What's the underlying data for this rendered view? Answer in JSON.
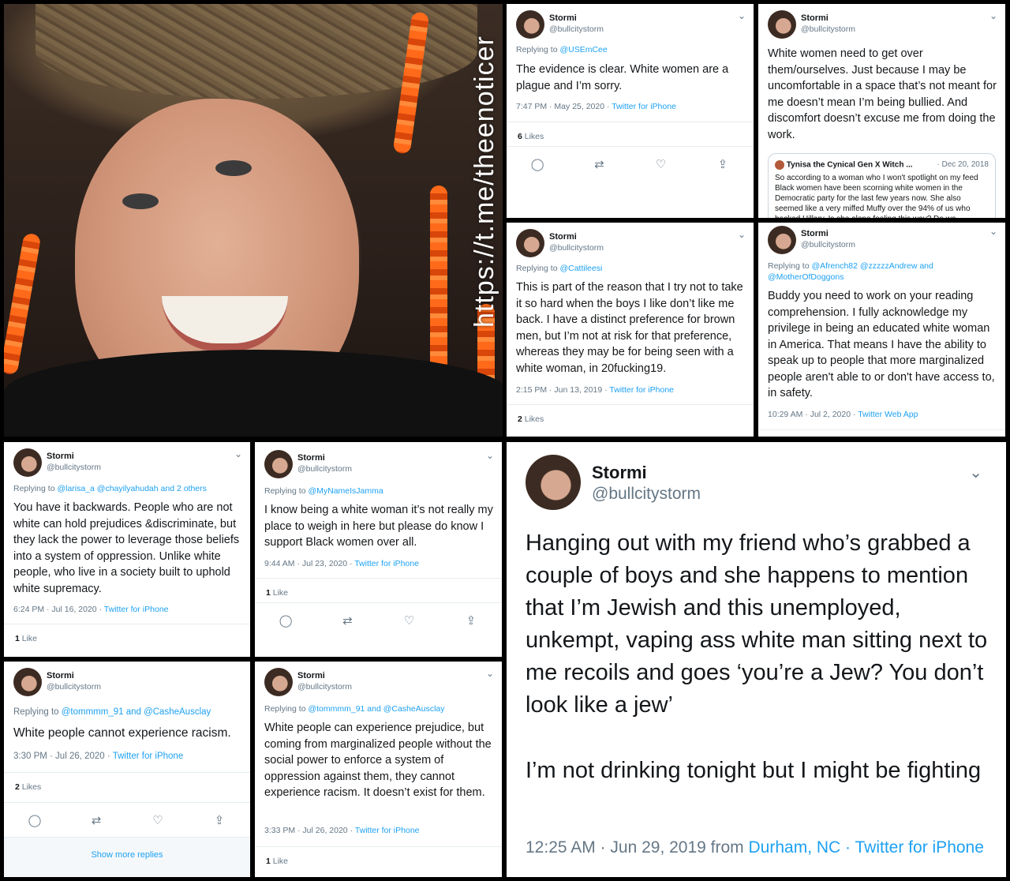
{
  "watermark": "https://t.me/theenoticer",
  "tweets": [
    {
      "name": "Stormi",
      "handle": "@bullcitystorm",
      "reply_prefix": "Replying to ",
      "reply_to": "@USEmCee",
      "text": "The evidence is clear. White women are a plague and I’m sorry.",
      "time": "7:47 PM · May 25, 2020 · ",
      "source": "Twitter for iPhone",
      "likes_count": "6",
      "likes_label": " Likes"
    },
    {
      "name": "Stormi",
      "handle": "@bullcitystorm",
      "text": "White women need to get over them/ourselves. Just because I may be uncomfortable in a space that’s not meant for me doesn’t mean I’m being bullied. And discomfort doesn’t excuse me from doing the work.",
      "quote_name": "Tynisa the Cynical Gen X Witch ...",
      "quote_date": "· Dec 20, 2018",
      "quote_text": "So according to a woman who I won't spotlight on my feed Black women have been scorning white women in the Democratic party for the last few years now. She also seemed like a very miffed Muffy over the 94% of us who backed Hillary. Is she alone feeling this way? Do we"
    },
    {
      "name": "Stormi",
      "handle": "@bullcitystorm",
      "reply_prefix": "Replying to ",
      "reply_to": "@Cattileesi",
      "text": "This is part of the reason that I try not to take it so hard when the boys I like don’t like me back. I have a distinct preference for brown men, but I’m not at risk for that preference, whereas they may be for being seen with a white woman, in 20fucking19.",
      "time": "2:15 PM · Jun 13, 2019 · ",
      "source": "Twitter for iPhone",
      "likes_count": "2",
      "likes_label": " Likes"
    },
    {
      "name": "Stormi",
      "handle": "@bullcitystorm",
      "reply_prefix": "Replying to ",
      "reply_to": "@Afrench82 @zzzzzAndrew and @MotherOfDoggons",
      "text": "Buddy you need to work on your reading comprehension. I fully acknowledge my privilege in being an educated white woman in America. That means I have the ability to speak up to people that more marginalized people aren't able to or don't have access to, in safety.",
      "time": "10:29 AM · Jul 2, 2020 · ",
      "source": "Twitter Web App"
    },
    {
      "name": "Stormi",
      "handle": "@bullcitystorm",
      "reply_prefix": "Replying to ",
      "reply_to": "@larisa_a @chayilyahudah and 2 others",
      "text": "You have it backwards. People who are not white can hold prejudices &discriminate, but they lack the power to leverage those beliefs into a system of oppression. Unlike white people, who live in a society built to uphold white supremacy.",
      "time": "6:24 PM · Jul 16, 2020 · ",
      "source": "Twitter for iPhone",
      "likes_count": "1",
      "likes_label": " Like"
    },
    {
      "name": "Stormi",
      "handle": "@bullcitystorm",
      "reply_prefix": "Replying to ",
      "reply_to": "@MyNameIsJamma",
      "text": "I know being a white woman it’s not really my place to weigh in here but please do know I support Black women over all.",
      "time": "9:44 AM · Jul 23, 2020 · ",
      "source": "Twitter for iPhone",
      "likes_count": "1",
      "likes_label": " Like"
    },
    {
      "name": "Stormi",
      "handle": "@bullcitystorm",
      "reply_prefix": "Replying to ",
      "reply_to": "@tommmm_91 and @CasheAusclay",
      "text": "White people cannot experience racism.",
      "time": "3:30 PM · Jul 26, 2020 · ",
      "source": "Twitter for iPhone",
      "likes_count": "2",
      "likes_label": " Likes",
      "show_more": "Show more replies"
    },
    {
      "name": "Stormi",
      "handle": "@bullcitystorm",
      "reply_prefix": "Replying to ",
      "reply_to": "@tommmm_91 and @CasheAusclay",
      "text": "White people can experience prejudice, but coming from marginalized people without the social power to enforce a system of oppression against them, they cannot experience racism. It doesn’t exist for them.",
      "time": "3:33 PM · Jul 26, 2020 · ",
      "source": "Twitter for iPhone",
      "likes_count": "1",
      "likes_label": " Like"
    },
    {
      "name": "Stormi",
      "handle": "@bullcitystorm",
      "text_1": "Hanging out with my friend who’s grabbed a couple of boys and she happens to mention that I’m Jewish and this unemployed, unkempt, vaping ass white man sitting next to me recoils and goes ‘you’re a Jew? You don’t look like a jew’",
      "text_2": "I’m not drinking tonight but I might be fighting",
      "time": "12:25 AM · Jun 29, 2019 from ",
      "location": "Durham, NC",
      "sep": " · ",
      "source": "Twitter for iPhone"
    }
  ],
  "icons": {
    "chevron": "⌄",
    "reply": "◯",
    "retweet": "⇄",
    "like": "♡",
    "share": "⇪"
  },
  "colors": {
    "link": "#1da1f2",
    "muted": "#657786",
    "accent_orange": "#ff6a1a"
  }
}
